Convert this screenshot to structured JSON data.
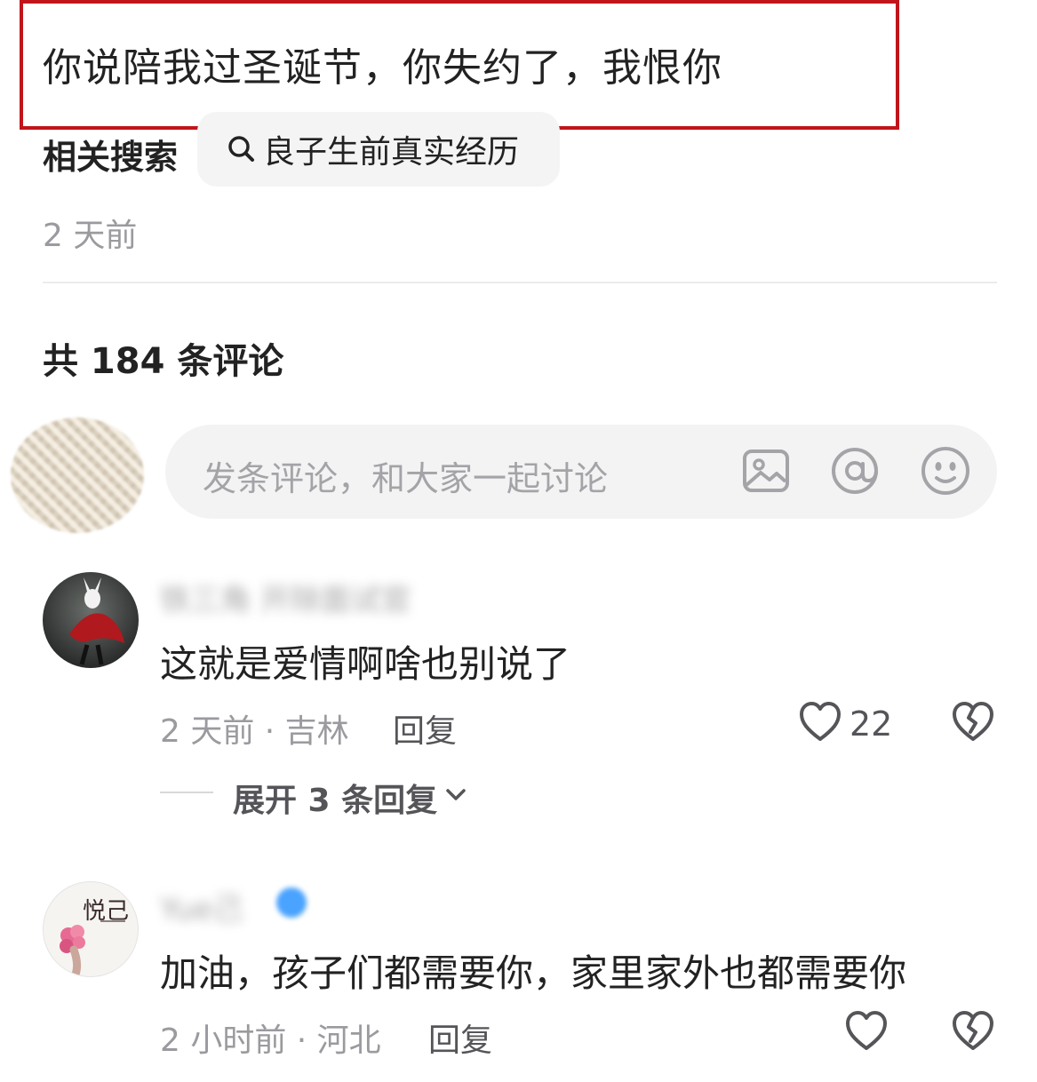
{
  "post": {
    "text": "你说陪我过圣诞节，你失约了，我恨你",
    "highlight_color": "#c0151b",
    "related_label": "相关搜索",
    "related_query": "良子生前真实经历",
    "time": "2 天前"
  },
  "comments_header": {
    "count_text": "共 184 条评论"
  },
  "composer": {
    "placeholder": "发条评论，和大家一起讨论",
    "icons": [
      "image-icon",
      "at-icon",
      "emoji-icon"
    ]
  },
  "comments": [
    {
      "username": "铁三角 开除面试官",
      "text": "这就是爱情啊啥也别说了",
      "meta": "2 天前 · 吉林",
      "reply_label": "回复",
      "likes": "22",
      "expand_label": "展开 3 条回复"
    },
    {
      "username": "Yue己",
      "avatar_text": "悦己",
      "text": "加油，孩子们都需要你，家里家外也都需要你",
      "meta": "2 小时前 · 河北",
      "reply_label": "回复",
      "likes": ""
    }
  ]
}
